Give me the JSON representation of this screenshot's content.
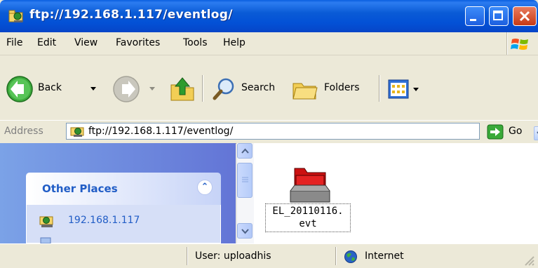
{
  "window": {
    "title": "ftp://192.168.1.117/eventlog/",
    "icon": "ftp-folder-icon",
    "controls": [
      "minimize-icon",
      "maximize-icon",
      "close-icon"
    ]
  },
  "menu": {
    "items": [
      {
        "label": "File",
        "accel": "F"
      },
      {
        "label": "Edit",
        "accel": "E"
      },
      {
        "label": "View",
        "accel": "V"
      },
      {
        "label": "Favorites",
        "accel": "a"
      },
      {
        "label": "Tools",
        "accel": "T"
      },
      {
        "label": "Help",
        "accel": "H"
      }
    ]
  },
  "toolbar": {
    "back_label": "Back",
    "search_label": "Search",
    "folders_label": "Folders",
    "icons": [
      "back-arrow-icon",
      "forward-arrow-icon",
      "up-folder-icon",
      "search-icon",
      "folders-icon",
      "views-icon"
    ]
  },
  "address": {
    "label": "Address",
    "value": "ftp://192.168.1.117/eventlog/",
    "go_label": "Go"
  },
  "tasks": {
    "section_title": "Other Places",
    "links": [
      "192.168.1.117"
    ]
  },
  "files": [
    {
      "name_line1": "EL_20110116.",
      "name_line2": "evt",
      "icon": "file-icon"
    }
  ],
  "status": {
    "user": "User: uploadhis",
    "zone": "Internet"
  },
  "colors": {
    "titlebar": "#0A5BD6",
    "task_pane": "#7BA2E7",
    "link": "#215DC6",
    "face": "#ECE9D8"
  }
}
